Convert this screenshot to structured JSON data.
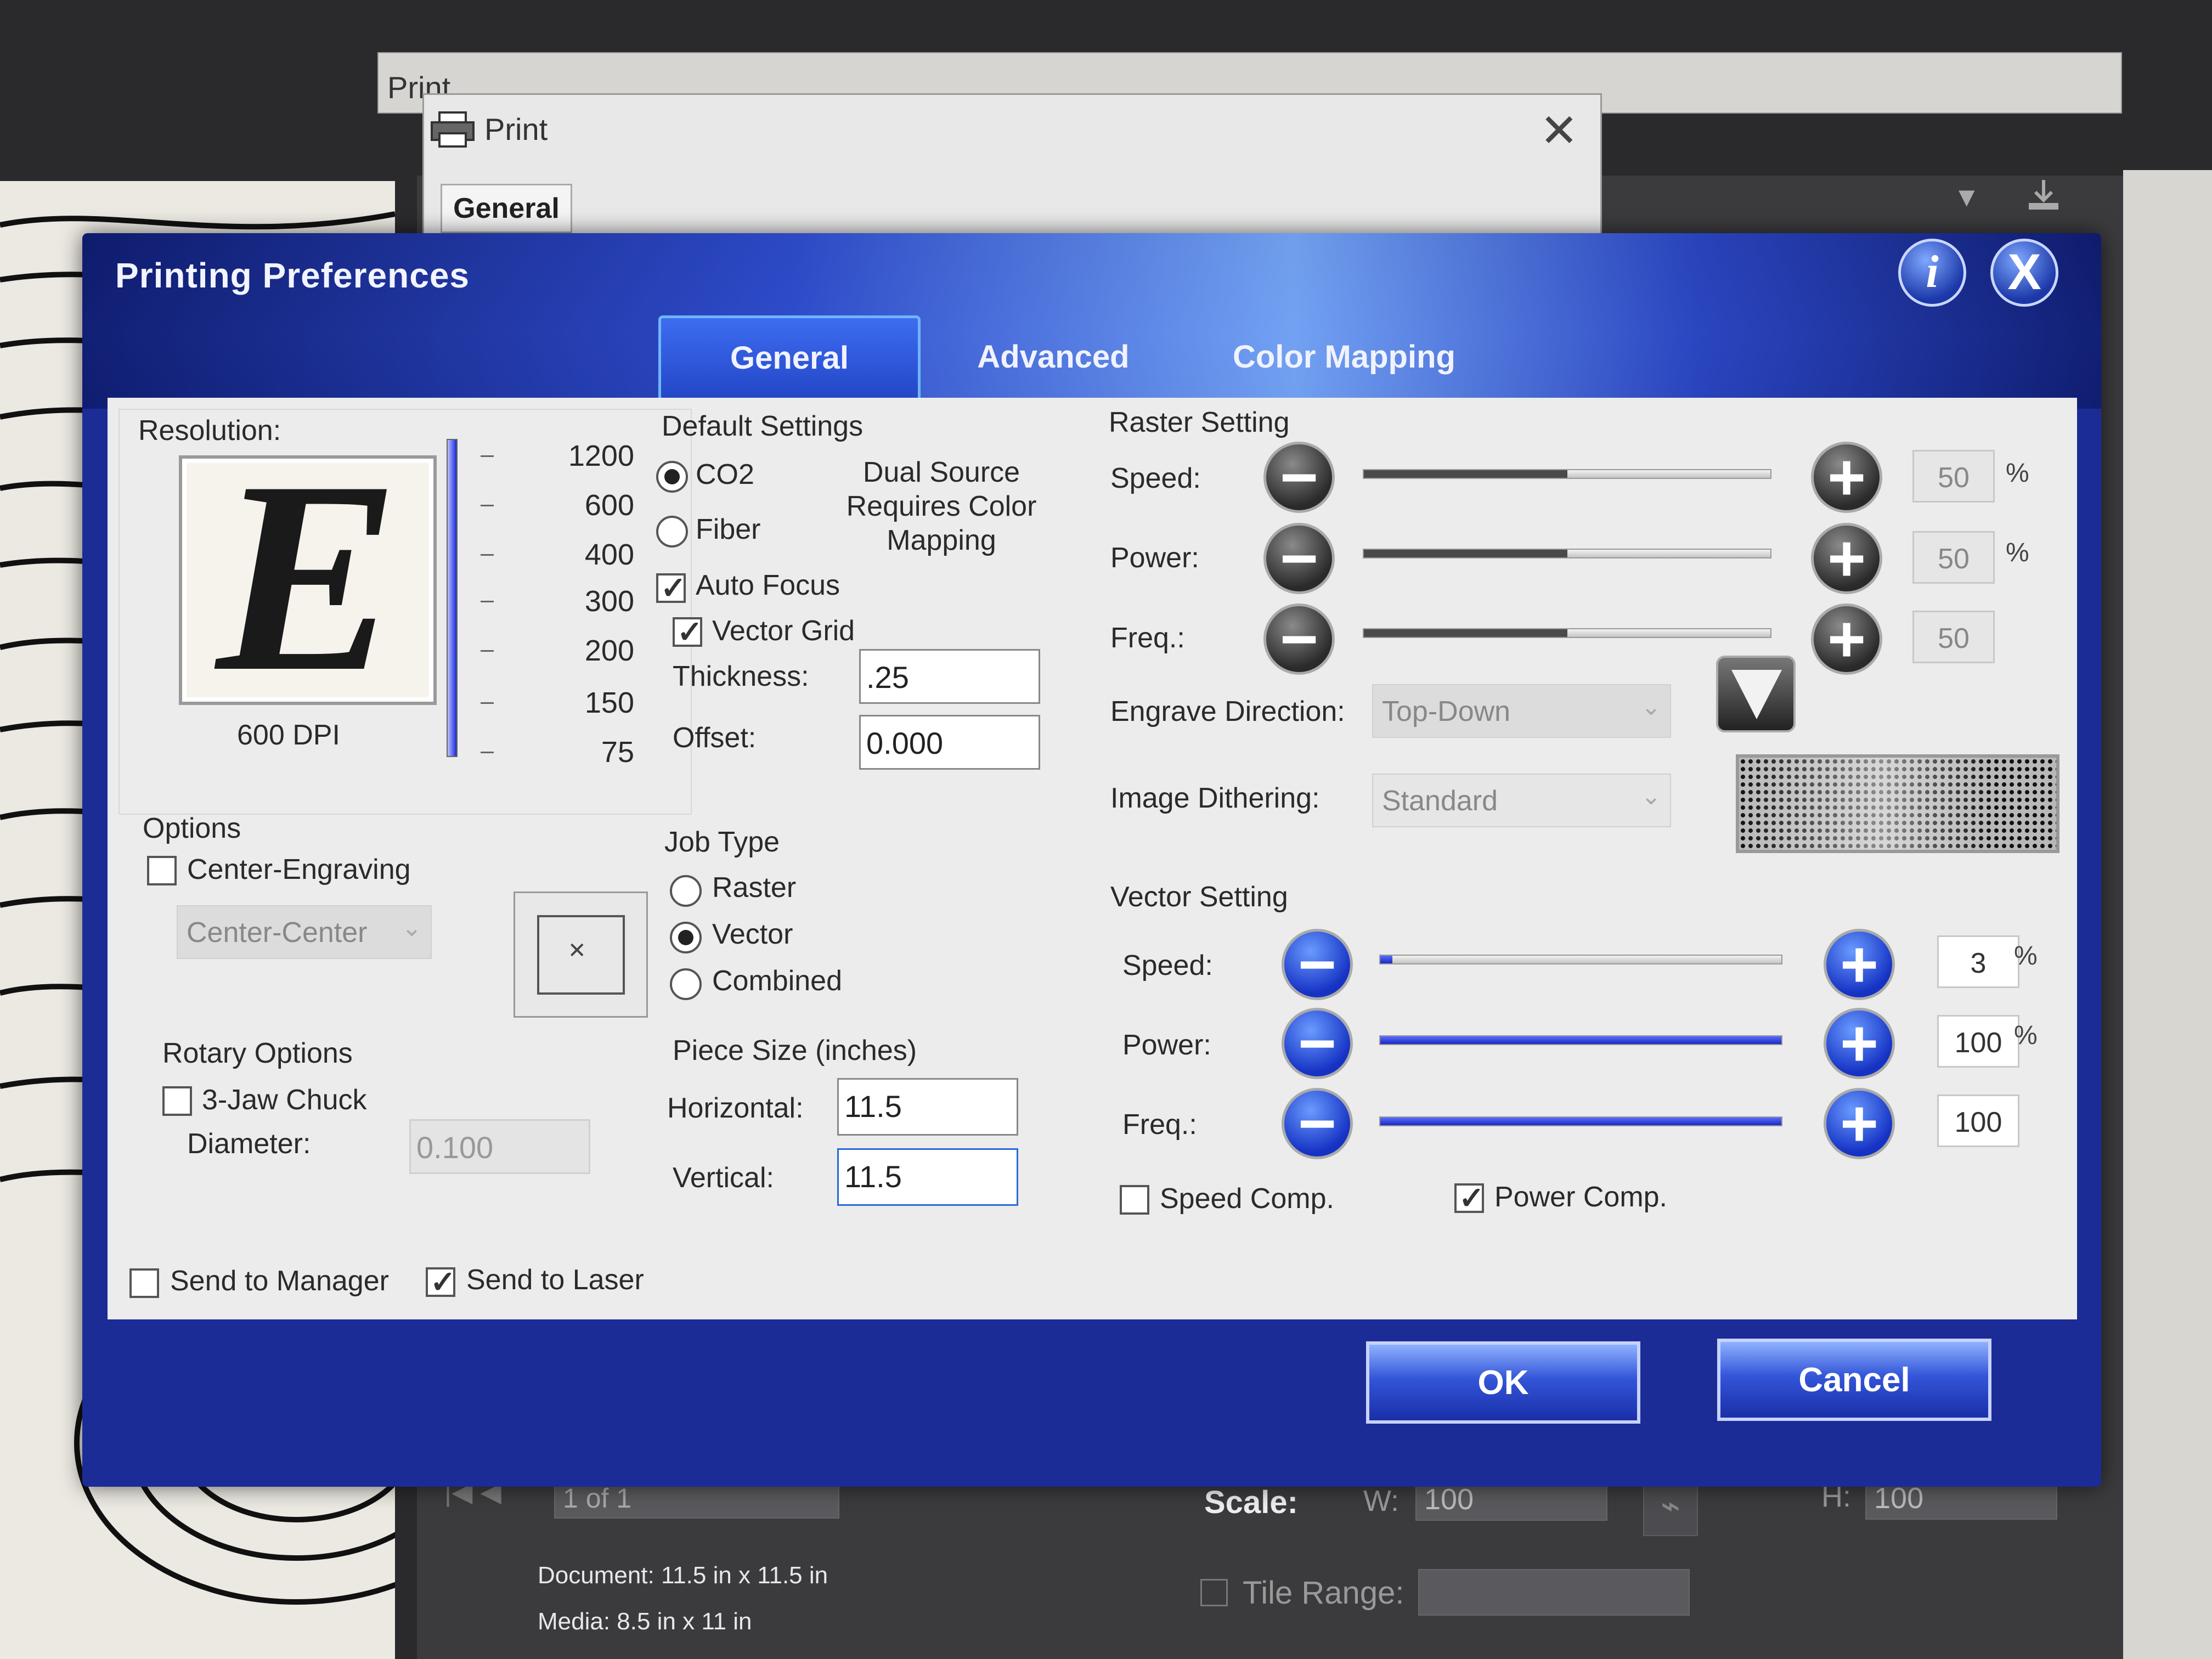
{
  "background": {
    "top_window_title": "Print",
    "print_dialog": {
      "title": "Print",
      "tab": "General",
      "close": "✕"
    },
    "page_nav": {
      "arrows": "|◀  ◀",
      "value": "1 of 1"
    },
    "document_label": "Document: 11.5 in x 11.5 in",
    "media_label": "Media: 8.5 in x 11 in",
    "scale_label": "Scale:",
    "w_label": "W:",
    "w_value": "100",
    "h_label": "H:",
    "h_value": "100",
    "tile_range_label": "Tile Range:"
  },
  "dialog": {
    "title": "Printing Preferences",
    "info_icon": "i",
    "close_icon": "X",
    "tabs": [
      "General",
      "Advanced",
      "Color Mapping"
    ],
    "active_tab": "General"
  },
  "resolution": {
    "label": "Resolution:",
    "logo_letter": "E",
    "dpi_caption": "600 DPI",
    "ticks": [
      "1200",
      "600",
      "400",
      "300",
      "200",
      "150",
      "75"
    ],
    "selected": "600"
  },
  "default_settings": {
    "label": "Default Settings",
    "co2_label": "CO2",
    "fiber_label": "Fiber",
    "source": "CO2",
    "note": "Dual Source Requires Color Mapping",
    "auto_focus_label": "Auto Focus",
    "auto_focus": true,
    "vector_grid_label": "Vector Grid",
    "vector_grid": true,
    "thickness_label": "Thickness:",
    "thickness": ".25",
    "offset_label": "Offset:",
    "offset": "0.000"
  },
  "options": {
    "label": "Options",
    "center_engraving_label": "Center-Engraving",
    "center_engraving": false,
    "center_mode": "Center-Center",
    "rotary_label": "Rotary Options",
    "chuck_label": "3-Jaw Chuck",
    "chuck": false,
    "diameter_label": "Diameter:",
    "diameter": "0.100"
  },
  "job_type": {
    "label": "Job Type",
    "raster_label": "Raster",
    "vector_label": "Vector",
    "combined_label": "Combined",
    "selected": "Vector"
  },
  "piece_size": {
    "label": "Piece Size (inches)",
    "horizontal_label": "Horizontal:",
    "horizontal": "11.5",
    "vertical_label": "Vertical:",
    "vertical": "11.5"
  },
  "raster": {
    "label": "Raster Setting",
    "speed_label": "Speed:",
    "speed": "50",
    "power_label": "Power:",
    "power": "50",
    "freq_label": "Freq.:",
    "freq": "50",
    "engrave_direction_label": "Engrave Direction:",
    "engrave_direction": "Top-Down",
    "dithering_label": "Image Dithering:",
    "dithering": "Standard"
  },
  "vector": {
    "label": "Vector Setting",
    "speed_label": "Speed:",
    "speed": "3",
    "power_label": "Power:",
    "power": "100",
    "freq_label": "Freq.:",
    "freq": "100",
    "speed_comp_label": "Speed Comp.",
    "speed_comp": false,
    "power_comp_label": "Power Comp.",
    "power_comp": true
  },
  "send_to_manager_label": "Send to Manager",
  "send_to_manager": false,
  "send_to_laser_label": "Send to Laser",
  "send_to_laser": true,
  "units": {
    "percent": "%"
  },
  "buttons": {
    "ok": "OK",
    "cancel": "Cancel"
  }
}
